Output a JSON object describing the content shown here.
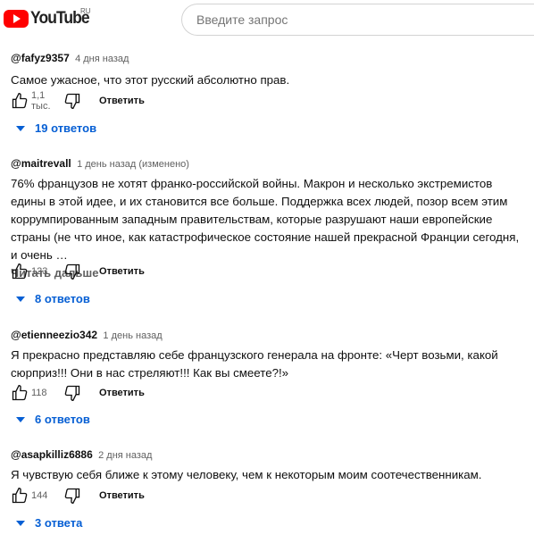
{
  "header": {
    "logo_text": "YouTube",
    "region": "RU",
    "search_placeholder": "Введите запрос"
  },
  "comments": [
    {
      "author": "@fafyz9357",
      "time": "4 дня назад",
      "text": "Самое ужасное, что этот русский абсолютно прав.",
      "likes": "1,1 тыс.",
      "reply_label": "Ответить",
      "replies_label": "19 ответов"
    },
    {
      "author": "@maitrevall",
      "time": "1 день назад (изменено)",
      "text": "76% французов не хотят франко-российской войны. Макрон и несколько экстремистов едины в этой идее, и их становится все больше. Поддержка всех людей, позор всем этим коррумпированным западным правительствам, которые разрушают наши европейские страны (не что иное, как катастрофическое состояние нашей прекрасной Франции сегодня, и очень …",
      "read_more": "Читать дальше",
      "likes": "123",
      "reply_label": "Ответить",
      "replies_label": "8 ответов"
    },
    {
      "author": "@etienneezio342",
      "time": "1 день назад",
      "text": "Я прекрасно представляю себе французского генерала на фронте: «Черт возьми, какой сюрприз!!! Они в нас стреляют!!! Как вы смеете?!»",
      "likes": "118",
      "reply_label": "Ответить",
      "replies_label": "6 ответов"
    },
    {
      "author": "@asapkilliz6886",
      "time": "2 дня назад",
      "text": "Я чувствую себя ближе к этому человеку, чем к некоторым моим соотечественникам.",
      "likes": "144",
      "reply_label": "Ответить",
      "replies_label": "3 ответа"
    }
  ],
  "colors": {
    "accent": "#065fd4",
    "logo_red": "#ff0000",
    "meta_text": "#606060"
  }
}
